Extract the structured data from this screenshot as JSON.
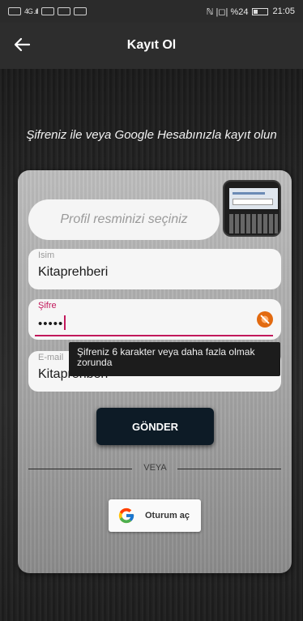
{
  "status_bar": {
    "signal": "4G .ıll",
    "right_info": "ℕ |◻| %24",
    "time": "21:05"
  },
  "app_bar": {
    "back_icon": "arrow-left-icon",
    "title": "Kayıt Ol"
  },
  "tagline": "Şifreniz ile veya Google Hesabınızla kayıt olun",
  "form": {
    "profile_button_label": "Profil resminizi seçiniz",
    "name_field": {
      "label": "Isim",
      "value": "Kitaprehberi"
    },
    "password_field": {
      "label": "Şifre",
      "value": "•••••",
      "error_icon": "error-icon"
    },
    "email_field": {
      "label": "E-mail",
      "value": "Kitaprehberi"
    },
    "password_error_tooltip": "Şifreniz 6 karakter veya daha fazla olmak zorunda",
    "submit_label": "GÖNDER",
    "divider_text": "VEYA",
    "google_button_label": "Oturum aç"
  },
  "colors": {
    "accent_error": "#c2185b",
    "submit_bg": "#0d1b26",
    "app_bar": "#2d2d2d"
  }
}
